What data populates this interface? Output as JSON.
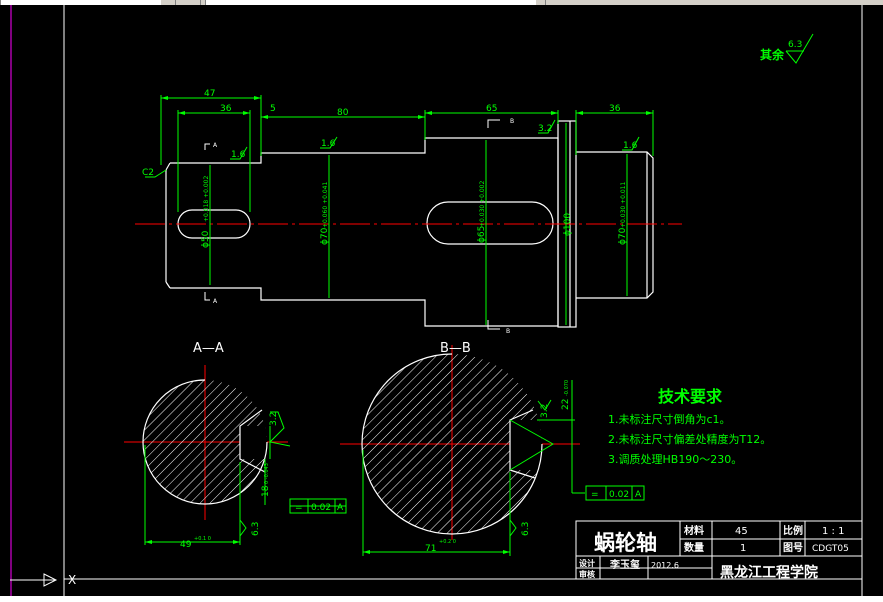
{
  "surface_finish_other": {
    "label": "其余",
    "value": "6.3"
  },
  "dimensions": {
    "d47": "47",
    "d36a": "36",
    "d5": "5",
    "d80": "80",
    "d65": "65",
    "d36b": "36",
    "rough16a": "1.6",
    "rough16b": "1.6",
    "rough32": "3.2",
    "rough16c": "1.6",
    "chamfer": "C2",
    "dia50": "ϕ50",
    "dia50_tol": "+0.018 +0.002",
    "dia70a": "ϕ70",
    "dia70a_tol": "+0.060 +0.041",
    "dia65": "ϕ65",
    "dia65_tol": "+0.030 +0.002",
    "dia100": "ϕ100",
    "dia70b": "ϕ70",
    "dia70b_tol": "+0.030 +0.011"
  },
  "section_marks": {
    "a1": "A",
    "a2": "A",
    "b1": "B",
    "b2": "B"
  },
  "section_aa": {
    "title": "A—A",
    "width": "49",
    "width_tol": "+0.1 0",
    "depth": "18",
    "depth_tol": "0 -0.043",
    "rough": "3.2",
    "rough2": "6.3",
    "tolerance_symbol": "=",
    "tolerance_value": "0.02",
    "datum": "A"
  },
  "section_bb": {
    "title": "B—B",
    "width": "71",
    "width_tol": "+0.2 0",
    "key": "22",
    "key_tol": "-0.070",
    "rough": "3.2",
    "rough2": "6.3",
    "tolerance_symbol": "=",
    "tolerance_value": "0.02",
    "datum": "A"
  },
  "tech_requirements": {
    "title": "技术要求",
    "items": [
      "1.未标注尺寸倒角为c1。",
      "2.未标注尺寸偏差处精度为T12。",
      "3.调质处理HB190～230。"
    ]
  },
  "title_block": {
    "part_name": "蜗轮轴",
    "material_label": "材料",
    "material_value": "45",
    "scale_label": "比例",
    "scale_value": "1 : 1",
    "quantity_label": "数量",
    "quantity_value": "1",
    "drawing_no_label": "图号",
    "drawing_no_value": "CDGT05",
    "designer_label": "设计",
    "designer_name": "李玉玺",
    "date": "2012.6",
    "review_label": "审核",
    "school": "黑龙江工程学院"
  },
  "ucs": {
    "x_label": "X"
  },
  "colors": {
    "background": "#000000",
    "lines": "#ffffff",
    "dimensions": "#00ff00",
    "centerlines": "#ff0000",
    "border": "#ff00ff",
    "tech_text": "#00ff00"
  }
}
